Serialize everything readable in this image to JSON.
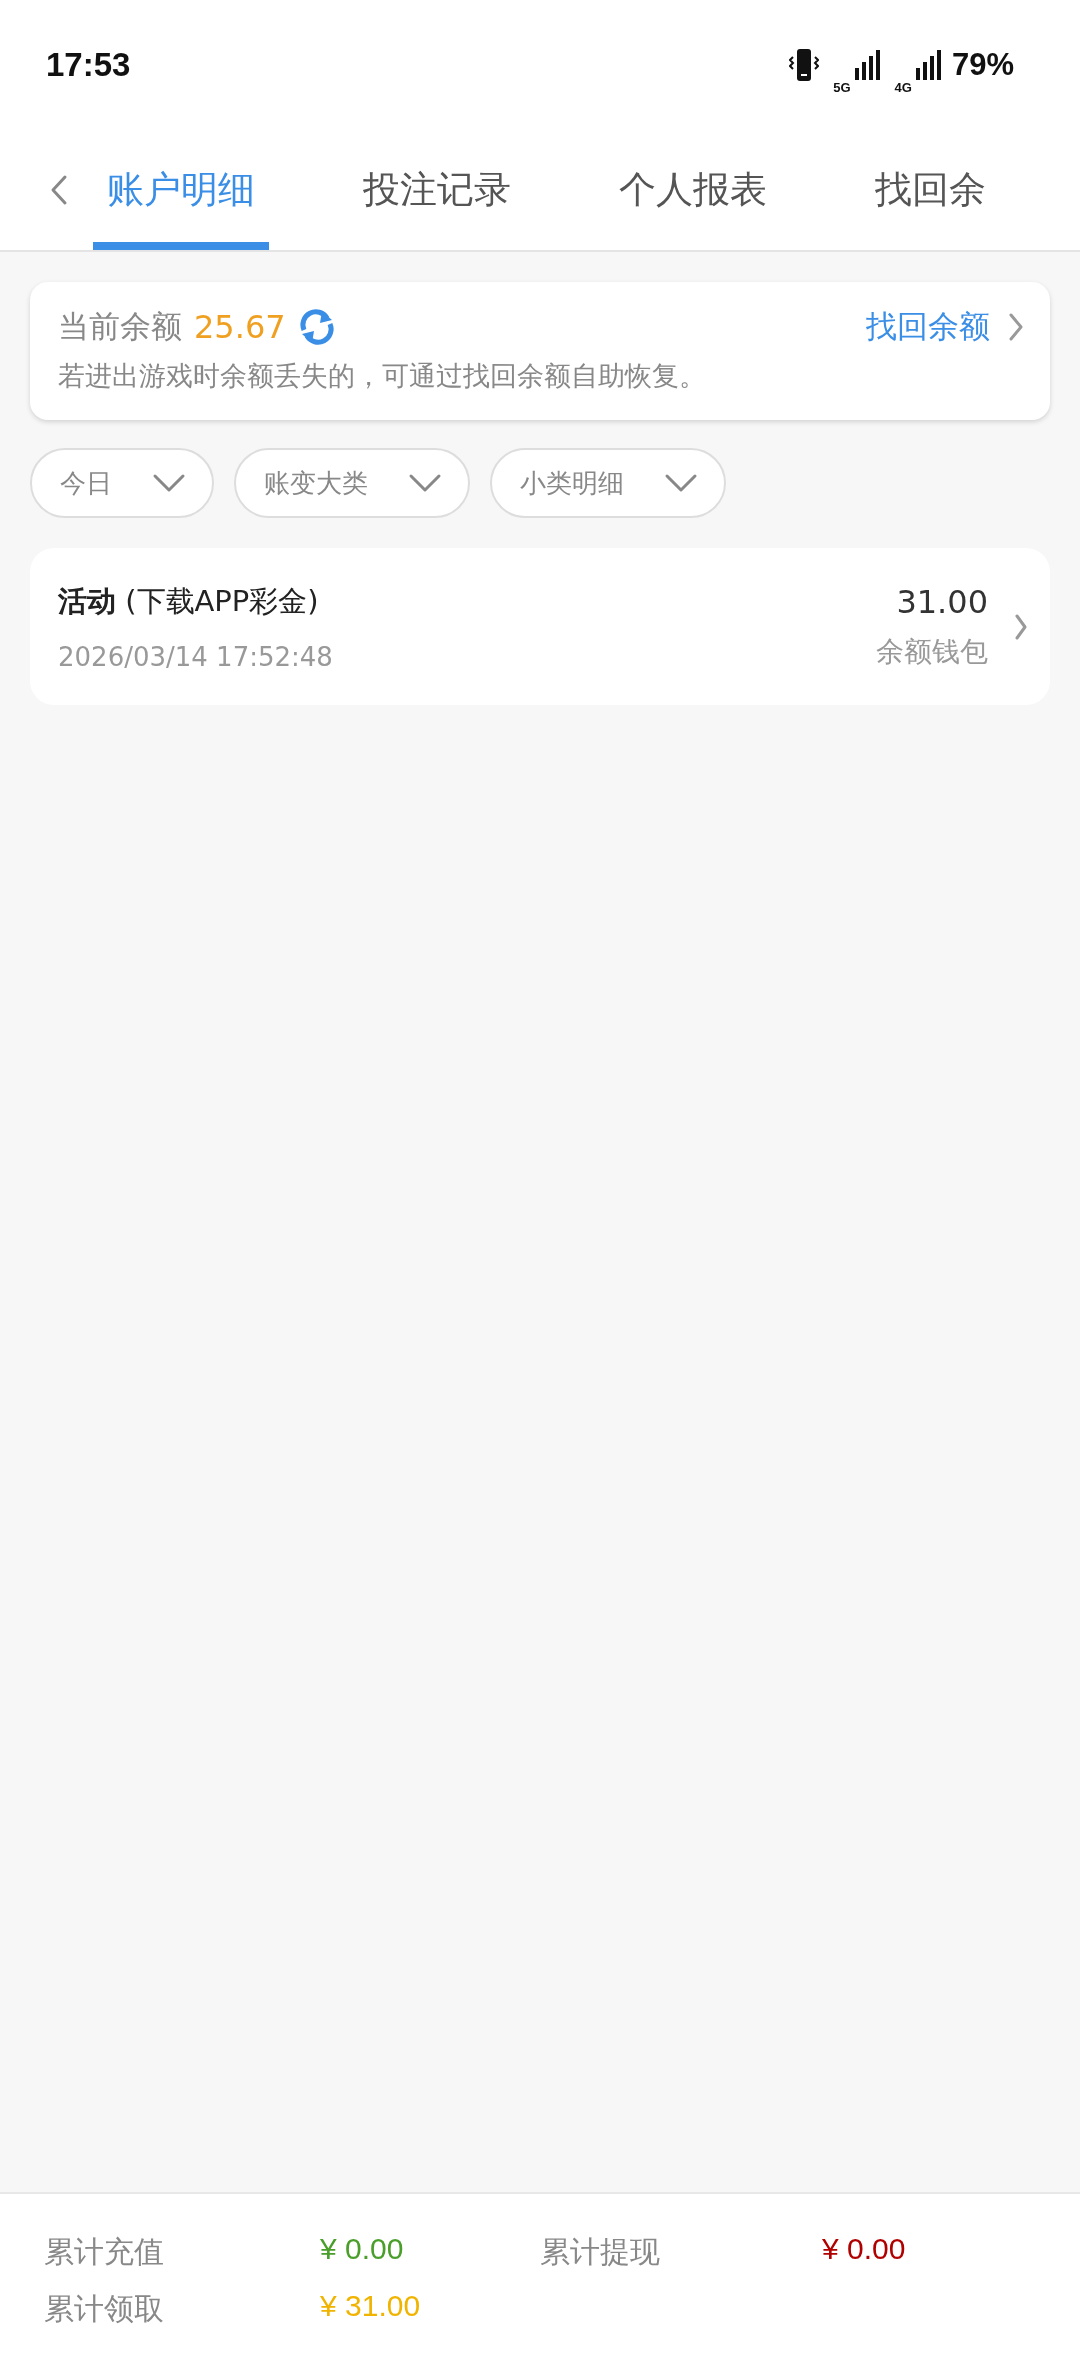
{
  "status_bar": {
    "time": "17:53",
    "network_1": "5G",
    "network_2": "4G",
    "battery": "79%"
  },
  "tabs": [
    {
      "label": "账户明细",
      "selected": true
    },
    {
      "label": "投注记录",
      "selected": false
    },
    {
      "label": "个人报表",
      "selected": false
    },
    {
      "label": "找回余",
      "selected": false
    }
  ],
  "balance_card": {
    "label": "当前余额",
    "amount": "25.67",
    "link": "找回余额",
    "note": "若进出游戏时余额丢失的，可通过找回余额自助恢复。"
  },
  "filters": [
    {
      "label": "今日"
    },
    {
      "label": "账变大类"
    },
    {
      "label": "小类明细"
    }
  ],
  "records": [
    {
      "title": "**活动** (下载APP彩金)",
      "time": "2026/03/14 17:52:48",
      "amount": "31.00",
      "wallet": "余额钱包"
    }
  ],
  "summary": [
    {
      "label": "累计充值",
      "value": "¥ 0.00",
      "color": "#4a9e2a"
    },
    {
      "label": "累计提现",
      "value": "¥ 0.00",
      "color": "#b00000"
    },
    {
      "label": "累计领取",
      "value": "¥ 31.00",
      "color": "#f0b400"
    }
  ]
}
